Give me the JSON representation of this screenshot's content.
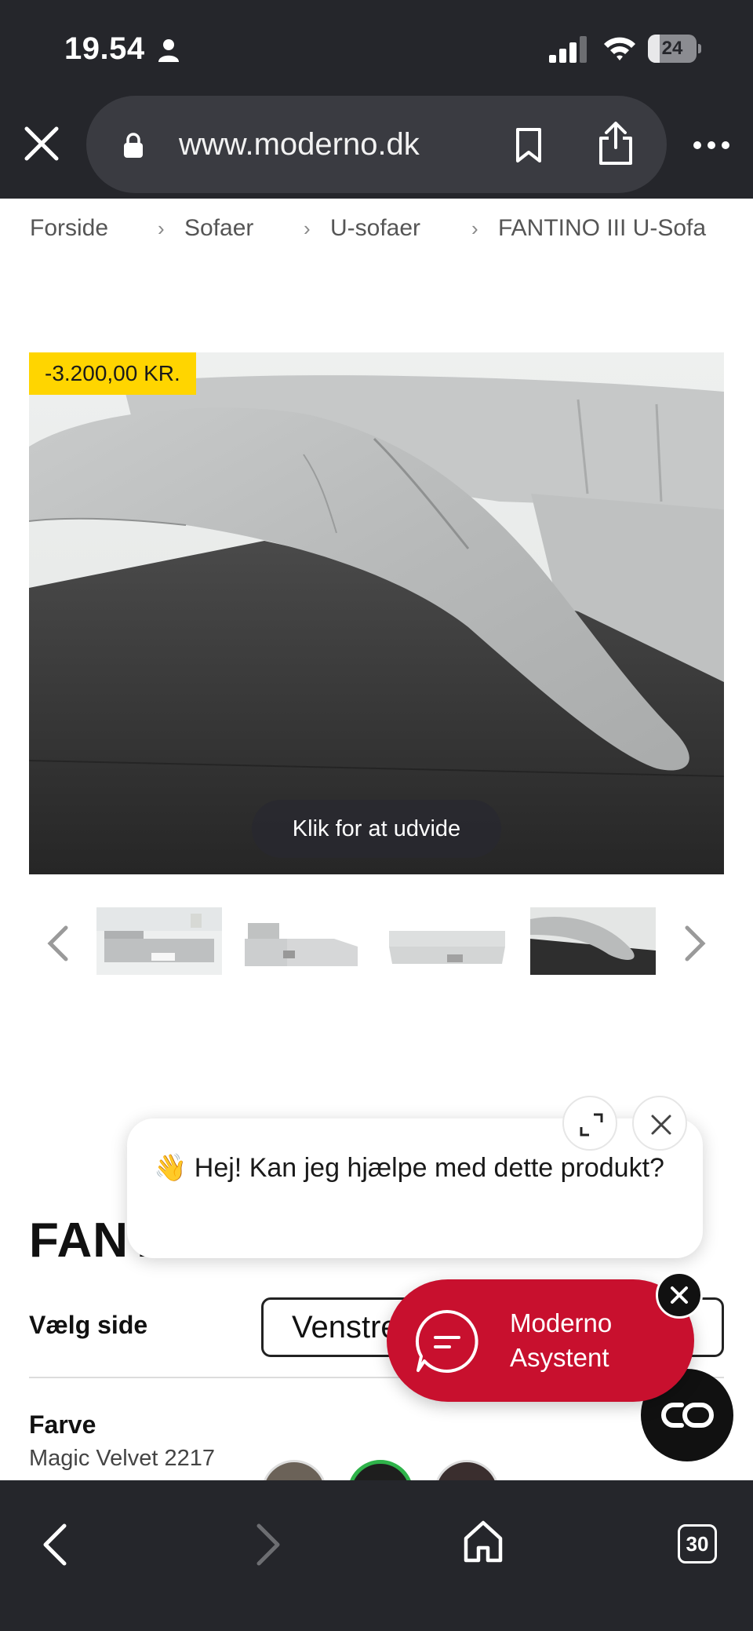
{
  "status_bar": {
    "time": "19.54",
    "battery": "24",
    "battery_level": 0.24
  },
  "browser": {
    "url": "www.moderno.dk",
    "tabs_count": "30"
  },
  "breadcrumb": [
    "Forside",
    "Sofaer",
    "U-sofaer",
    "FANTINO III U-Sofa"
  ],
  "hero": {
    "discount_badge": "-3.200,00 KR.",
    "expand_hint": "Klik for at udvide"
  },
  "thumbnails": {
    "count": 4,
    "active_index": 3
  },
  "chat": {
    "greeting": "👋 Hej! Kan jeg hjælpe med dette produkt?"
  },
  "product": {
    "title": "FANTINO III U-Sofa",
    "side_label": "Vælg side",
    "side_value": "Venstre",
    "color_label": "Farve",
    "color_value": "Magic Velvet 2217",
    "swatch_colors": [
      "#6b6258",
      "#1e1e1e",
      "#3a2e2e"
    ]
  },
  "assistant": {
    "label_line1": "Moderno",
    "label_line2": "Asystent",
    "brand_color": "#c8102e"
  },
  "colors": {
    "chrome_bg": "#25262b",
    "url_pill_bg": "#3a3b41",
    "badge_yellow": "#ffd500"
  }
}
